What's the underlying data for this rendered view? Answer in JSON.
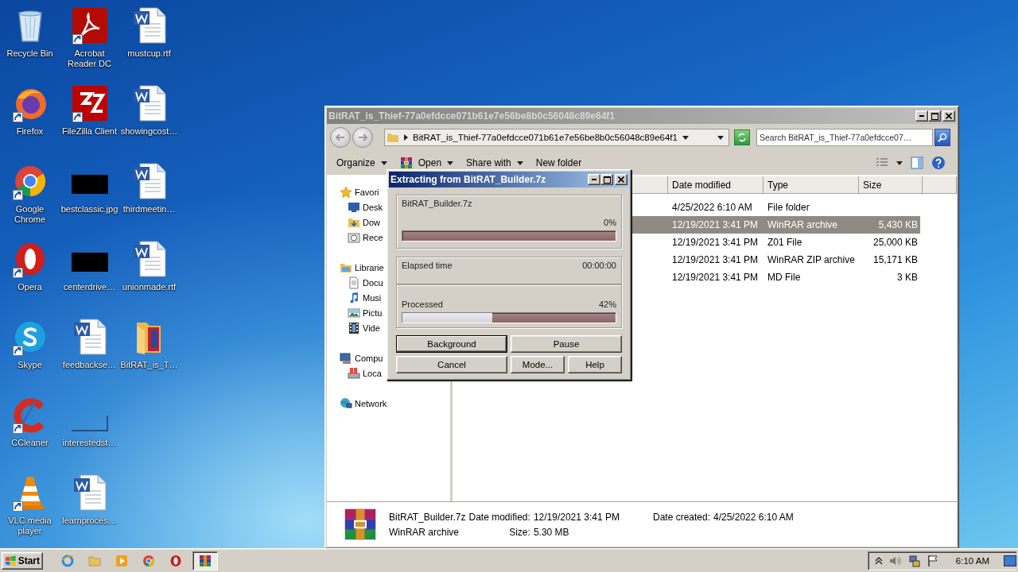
{
  "desktop_icons": [
    {
      "label": "Recycle Bin",
      "kind": "recycle",
      "shortcut": false
    },
    {
      "label": "Firefox",
      "kind": "firefox",
      "shortcut": true
    },
    {
      "label": "Google\nChrome",
      "kind": "chrome",
      "shortcut": true
    },
    {
      "label": "Opera",
      "kind": "opera",
      "shortcut": true
    },
    {
      "label": "Skype",
      "kind": "skype",
      "shortcut": true
    },
    {
      "label": "CCleaner",
      "kind": "ccleaner",
      "shortcut": true
    },
    {
      "label": "VLC media\nplayer",
      "kind": "vlc",
      "shortcut": true
    },
    {
      "label": "Acrobat\nReader DC",
      "kind": "pdf",
      "shortcut": true
    },
    {
      "label": "FileZilla Client",
      "kind": "filezilla",
      "shortcut": true
    },
    {
      "label": "bestclassic.jpg",
      "kind": "image",
      "shortcut": false
    },
    {
      "label": "centerdrive…",
      "kind": "image",
      "shortcut": false
    },
    {
      "label": "feedbackse…",
      "kind": "doc",
      "shortcut": false
    },
    {
      "label": "interestedst…",
      "kind": "blank",
      "shortcut": false
    },
    {
      "label": "learnproces…",
      "kind": "doc",
      "shortcut": false
    },
    {
      "label": "mustcup.rtf",
      "kind": "doc",
      "shortcut": false
    },
    {
      "label": "showingcost…",
      "kind": "doc",
      "shortcut": false
    },
    {
      "label": "thirdmeetin…",
      "kind": "doc",
      "shortcut": false
    },
    {
      "label": "unionmade.rtf",
      "kind": "doc",
      "shortcut": false
    },
    {
      "label": "BitRAT_is_T…",
      "kind": "folder",
      "shortcut": false
    }
  ],
  "explorer": {
    "title": "BitRAT_is_Thief-77a0efdcce071b61e7e56be8b0c56048c89e64f1",
    "active": false,
    "address": "BitRAT_is_Thief-77a0efdcce071b61e7e56be8b0c56048c89e64f1",
    "search": {
      "placeholder": "Search BitRAT_is_Thief-77a0efdcce07…"
    },
    "toolbar": [
      {
        "label": "Organize",
        "kind": "menu"
      },
      {
        "label": "Open",
        "kind": "open"
      },
      {
        "label": "Share with",
        "kind": "menu"
      },
      {
        "label": "New folder",
        "kind": "plain"
      }
    ],
    "nav": [
      {
        "label": "Favori",
        "kind": "star",
        "children": [
          {
            "label": "Desk",
            "kind": "desktop"
          },
          {
            "label": "Dow",
            "kind": "downloads"
          },
          {
            "label": "Rece",
            "kind": "recent"
          }
        ]
      },
      {
        "label": "Librarie",
        "kind": "library",
        "children": [
          {
            "label": "Docu",
            "kind": "documents"
          },
          {
            "label": "Musi",
            "kind": "music"
          },
          {
            "label": "Pictu",
            "kind": "pictures"
          },
          {
            "label": "Vide",
            "kind": "videos"
          }
        ]
      },
      {
        "label": "Compu",
        "kind": "computer",
        "children": [
          {
            "label": "Loca",
            "kind": "drive"
          }
        ]
      },
      {
        "label": "Network",
        "kind": "network"
      }
    ],
    "columns": [
      "Date modified",
      "Type",
      "Size"
    ],
    "rows": [
      {
        "date": "4/25/2022 6:10 AM",
        "type": "File folder",
        "selected": false
      },
      {
        "date": "12/19/2021 3:41 PM",
        "type": "WinRAR archive",
        "size": "5,430 KB",
        "selected": true
      },
      {
        "date": "12/19/2021 3:41 PM",
        "type": "Z01 File",
        "size": "25,000 KB",
        "selected": false
      },
      {
        "date": "12/19/2021 3:41 PM",
        "type": "WinRAR ZIP archive",
        "size": "15,171 KB",
        "selected": false
      },
      {
        "date": "12/19/2021 3:41 PM",
        "type": "MD File",
        "size": "3 KB",
        "selected": false
      }
    ],
    "details": {
      "name": "BitRAT_Builder.7z",
      "type": "WinRAR archive",
      "fields": [
        {
          "label": "Date modified:",
          "value": "12/19/2021 3:41 PM"
        },
        {
          "label": "Date created:",
          "value": "4/25/2022 6:10 AM"
        },
        {
          "label": "Size:",
          "value": "5.30 MB"
        }
      ]
    }
  },
  "dialog": {
    "title": "Extracting from BitRAT_Builder.7z",
    "active": true,
    "archive": {
      "name": "BitRAT_Builder.7z",
      "percent": "0%"
    },
    "elapsed": {
      "label": "Elapsed time",
      "value": "00:00:00"
    },
    "processed": {
      "label": "Processed",
      "percent": "42%",
      "level": 0.42
    },
    "buttons": [
      {
        "label": "Background",
        "focused": true
      },
      {
        "label": "Pause",
        "focused": false
      },
      {
        "label": "Cancel",
        "focused": false
      },
      {
        "label": "Mode...",
        "focused": false
      },
      {
        "label": "Help",
        "focused": false
      }
    ]
  },
  "taskbar": {
    "start": "Start",
    "apps": [
      {
        "kind": "ie",
        "active": false
      },
      {
        "kind": "explorer",
        "active": false
      },
      {
        "kind": "media",
        "active": false
      },
      {
        "kind": "chrome",
        "active": false
      },
      {
        "kind": "opera",
        "active": false
      },
      {
        "kind": "winrar",
        "active": true
      }
    ],
    "clock": "6:10 AM"
  }
}
